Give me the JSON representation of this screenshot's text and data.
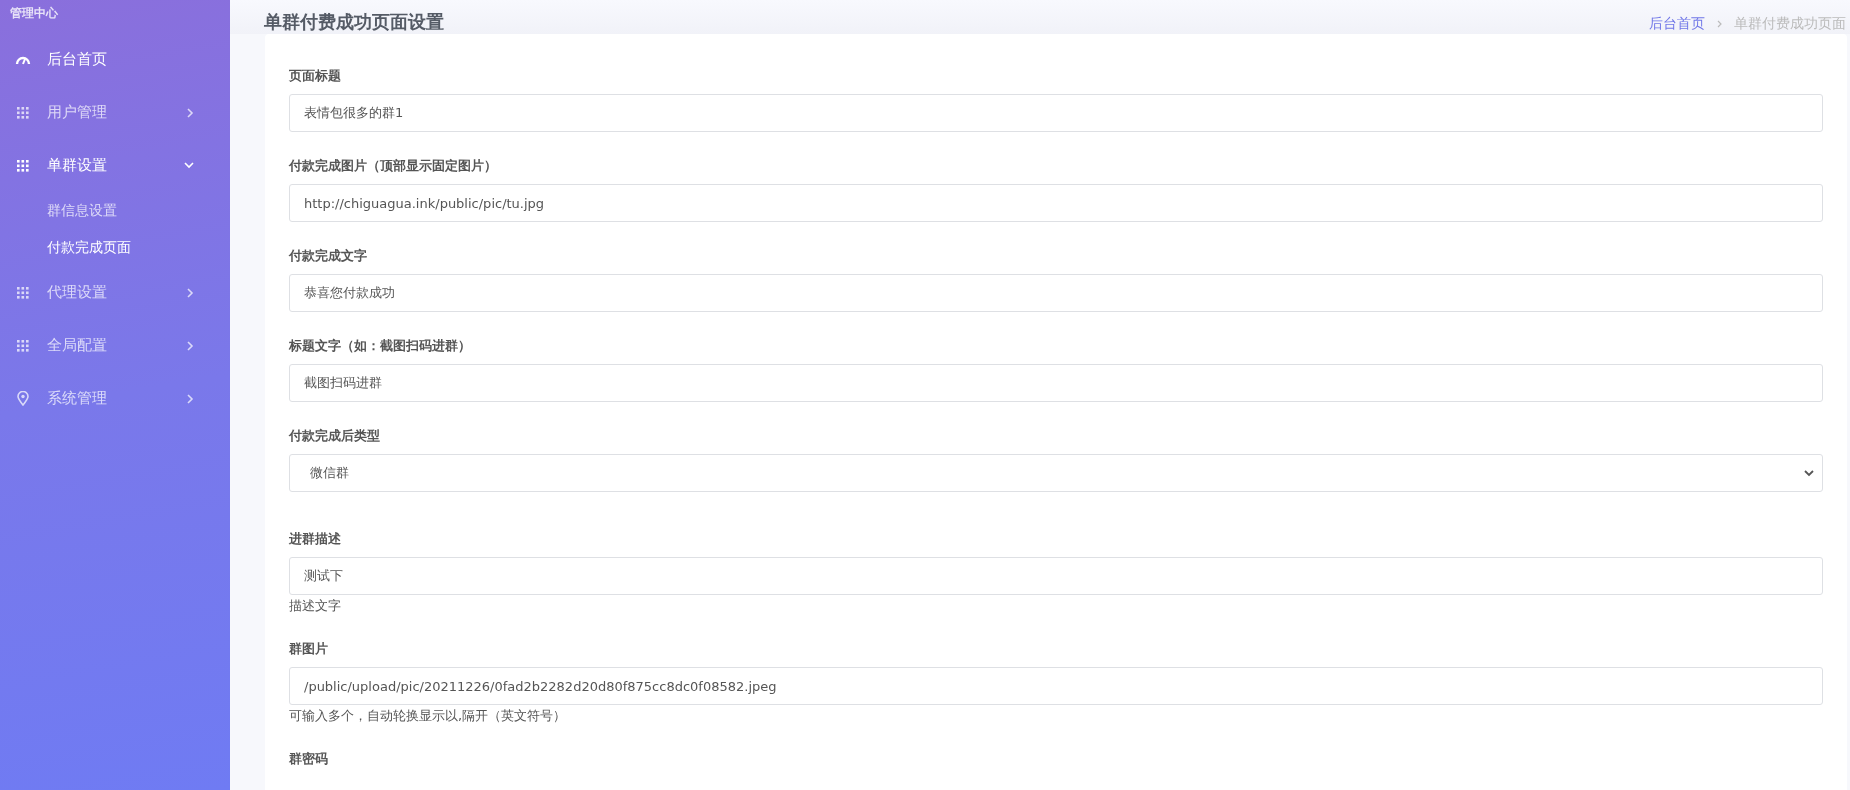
{
  "sidebar": {
    "title": "管理中心",
    "items": [
      {
        "label": "后台首页",
        "kind": "gauge",
        "selected": true
      },
      {
        "label": "用户管理",
        "kind": "grid",
        "selected": false,
        "expanded": false
      },
      {
        "label": "单群设置",
        "kind": "grid",
        "selected": true,
        "expanded": true,
        "children": [
          {
            "label": "群信息设置",
            "selected": false
          },
          {
            "label": "付款完成页面",
            "selected": true
          }
        ]
      },
      {
        "label": "代理设置",
        "kind": "grid",
        "selected": false,
        "expanded": false
      },
      {
        "label": "全局配置",
        "kind": "grid",
        "selected": false,
        "expanded": false
      },
      {
        "label": "系统管理",
        "kind": "pin",
        "selected": false,
        "expanded": false
      }
    ]
  },
  "header": {
    "title": "单群付费成功页面设置",
    "breadcrumb": [
      "后台首页",
      "单群付费成功页面"
    ]
  },
  "form": {
    "fields": [
      {
        "kind": "input",
        "label": "页面标题",
        "value": "表情包很多的群1"
      },
      {
        "kind": "input",
        "label": "付款完成图片（顶部显示固定图片）",
        "value": "http://chiguagua.ink/public/pic/tu.jpg"
      },
      {
        "kind": "input",
        "label": "付款完成文字",
        "value": "恭喜您付款成功"
      },
      {
        "kind": "input",
        "label": "标题文字（如：截图扫码进群）",
        "value": "截图扫码进群"
      },
      {
        "kind": "select",
        "label": "付款完成后类型",
        "value": "微信群"
      },
      {
        "kind": "input",
        "label": "进群描述",
        "value": "测试下",
        "help": "描述文字"
      },
      {
        "kind": "input",
        "label": "群图片",
        "value": "/public/upload/pic/20211226/0fad2b2282d20d80f875cc8dc0f08582.jpeg",
        "help": "可输入多个，自动轮换显示以,隔开（英文符号）"
      },
      {
        "kind": "label",
        "label": "群密码"
      }
    ]
  }
}
